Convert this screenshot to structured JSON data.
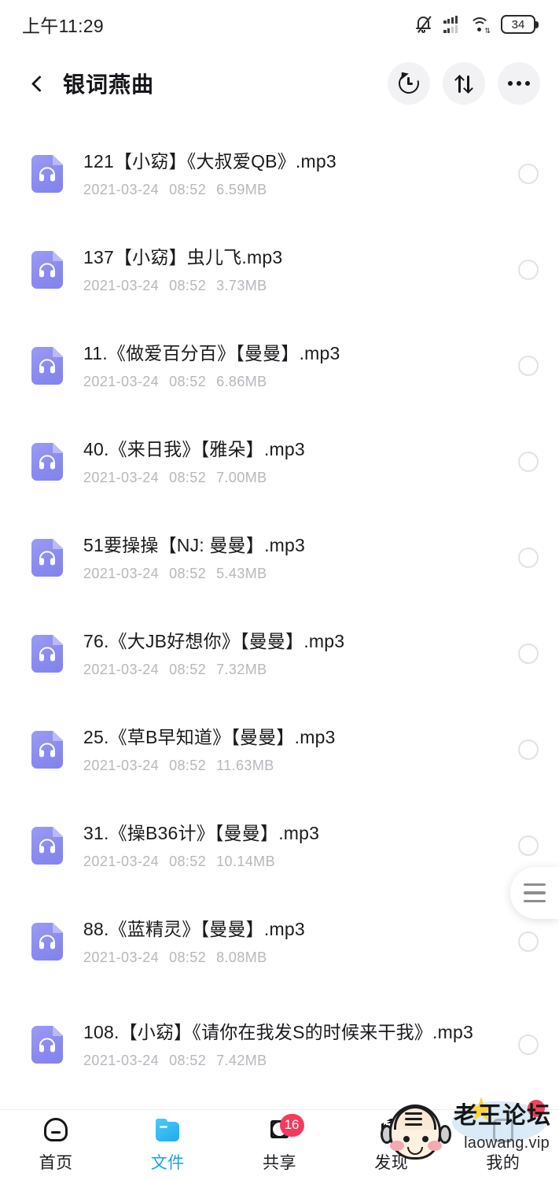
{
  "status_bar": {
    "time": "上午11:29",
    "battery_level": "34",
    "icons": [
      "bell-muted-icon",
      "signal-icon",
      "wifi-icon",
      "battery-icon"
    ]
  },
  "app_bar": {
    "title": "银词燕曲",
    "back_icon": "chevron-left-icon",
    "actions": [
      {
        "name": "history-button",
        "icon": "history-icon"
      },
      {
        "name": "sort-button",
        "icon": "sort-arrows-icon"
      },
      {
        "name": "more-button",
        "icon": "more-dots-icon"
      }
    ]
  },
  "files": [
    {
      "name": "121【小窈】《大叔爱QB》.mp3",
      "date": "2021-03-24",
      "time": "08:52",
      "size": "6.59MB"
    },
    {
      "name": "137【小窈】虫儿飞.mp3",
      "date": "2021-03-24",
      "time": "08:52",
      "size": "3.73MB"
    },
    {
      "name": "11.《做爱百分百》【曼曼】.mp3",
      "date": "2021-03-24",
      "time": "08:52",
      "size": "6.86MB"
    },
    {
      "name": "40.《来日我》【雅朵】.mp3",
      "date": "2021-03-24",
      "time": "08:52",
      "size": "7.00MB"
    },
    {
      "name": "51要操操【NJ: 曼曼】.mp3",
      "date": "2021-03-24",
      "time": "08:52",
      "size": "5.43MB"
    },
    {
      "name": "76.《大JB好想你》【曼曼】.mp3",
      "date": "2021-03-24",
      "time": "08:52",
      "size": "7.32MB"
    },
    {
      "name": "25.《草B早知道》【曼曼】.mp3",
      "date": "2021-03-24",
      "time": "08:52",
      "size": "11.63MB"
    },
    {
      "name": "31.《操B36计》【曼曼】.mp3",
      "date": "2021-03-24",
      "time": "08:52",
      "size": "10.14MB"
    },
    {
      "name": "88.《蓝精灵》【曼曼】.mp3",
      "date": "2021-03-24",
      "time": "08:52",
      "size": "8.08MB"
    },
    {
      "name": "108.【小窈】《请你在我发S的时候来干我》.mp3",
      "date": "2021-03-24",
      "time": "08:52",
      "size": "7.42MB"
    }
  ],
  "scroll_handle": {
    "icon": "scroll-thumb-icon"
  },
  "bottom_nav": {
    "items": [
      {
        "label": "首页",
        "icon": "home-cloud-icon",
        "active": false
      },
      {
        "label": "文件",
        "icon": "folder-icon",
        "active": true
      },
      {
        "label": "共享",
        "icon": "share-loops-icon",
        "active": false,
        "badge": "16"
      },
      {
        "label": "发现",
        "icon": "discover-hex-icon",
        "active": false
      },
      {
        "label": "我的",
        "icon": "profile-icon",
        "active": false
      }
    ],
    "active_color": "#18a0e8"
  },
  "watermark": {
    "title": "老王论坛",
    "url": "laowang.vip"
  },
  "colors": {
    "file_icon": "#8a8bf0",
    "accent": "#18a0e8",
    "badge": "#f73a5c",
    "meta_text": "#b7b7bd"
  }
}
